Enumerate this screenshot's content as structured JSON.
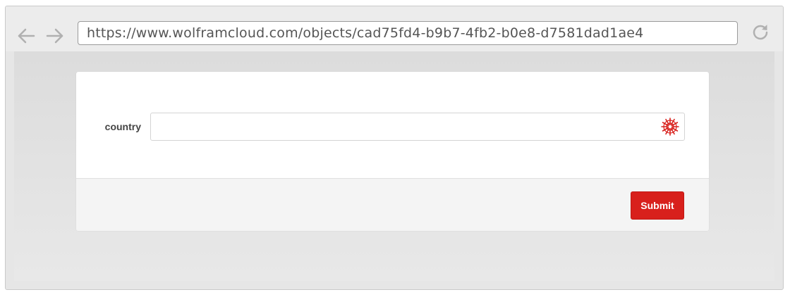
{
  "browser": {
    "url": "https://www.wolframcloud.com/objects/cad75fd4-b9b7-4fb2-b0e8-d7581dad1ae4",
    "back_icon": "arrow-left-icon",
    "forward_icon": "arrow-right-icon",
    "reload_icon": "reload-icon"
  },
  "form": {
    "fields": [
      {
        "label": "country",
        "value": "",
        "placeholder": "",
        "icon": "wolfram-spikey-icon"
      }
    ],
    "submit_label": "Submit"
  },
  "colors": {
    "accent": "#d8201c",
    "icon_gray": "#b0b0b0"
  }
}
